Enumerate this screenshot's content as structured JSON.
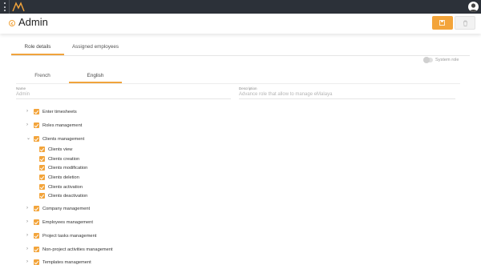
{
  "header": {
    "title": "Admin"
  },
  "tabs": [
    {
      "label": "Role details",
      "active": true
    },
    {
      "label": "Assigned employees",
      "active": false
    }
  ],
  "system_role": {
    "label": "System role",
    "enabled": false
  },
  "language_tabs": [
    {
      "label": "French",
      "active": false
    },
    {
      "label": "English",
      "active": true
    }
  ],
  "fields": {
    "name": {
      "label": "Name",
      "value": "Admin"
    },
    "description": {
      "label": "Description",
      "value": "Advance role that allow to manage eMalaya"
    }
  },
  "permissions": [
    {
      "label": "Enter timesheets",
      "expanded": false,
      "checked": true
    },
    {
      "label": "Roles management",
      "expanded": false,
      "checked": true
    },
    {
      "label": "Clients management",
      "expanded": true,
      "checked": true,
      "children": [
        {
          "label": "Clients view",
          "checked": true
        },
        {
          "label": "Clients creation",
          "checked": true
        },
        {
          "label": "Clients modification",
          "checked": true
        },
        {
          "label": "Clients deletion",
          "checked": true
        },
        {
          "label": "Clients activation",
          "checked": true
        },
        {
          "label": "Clients deactivation",
          "checked": true
        }
      ]
    },
    {
      "label": "Company management",
      "expanded": false,
      "checked": true
    },
    {
      "label": "Employees management",
      "expanded": false,
      "checked": true
    },
    {
      "label": "Project tasks management",
      "expanded": false,
      "checked": true
    },
    {
      "label": "Non-project activities management",
      "expanded": false,
      "checked": true
    },
    {
      "label": "Templates management",
      "expanded": false,
      "checked": true
    }
  ],
  "colors": {
    "accent": "#f3a43a",
    "topbar": "#2c3139"
  },
  "icons": {
    "menu": "menu-dots-icon",
    "logo": "app-logo",
    "back": "back-circle-icon",
    "save": "save-icon",
    "delete": "trash-icon"
  }
}
